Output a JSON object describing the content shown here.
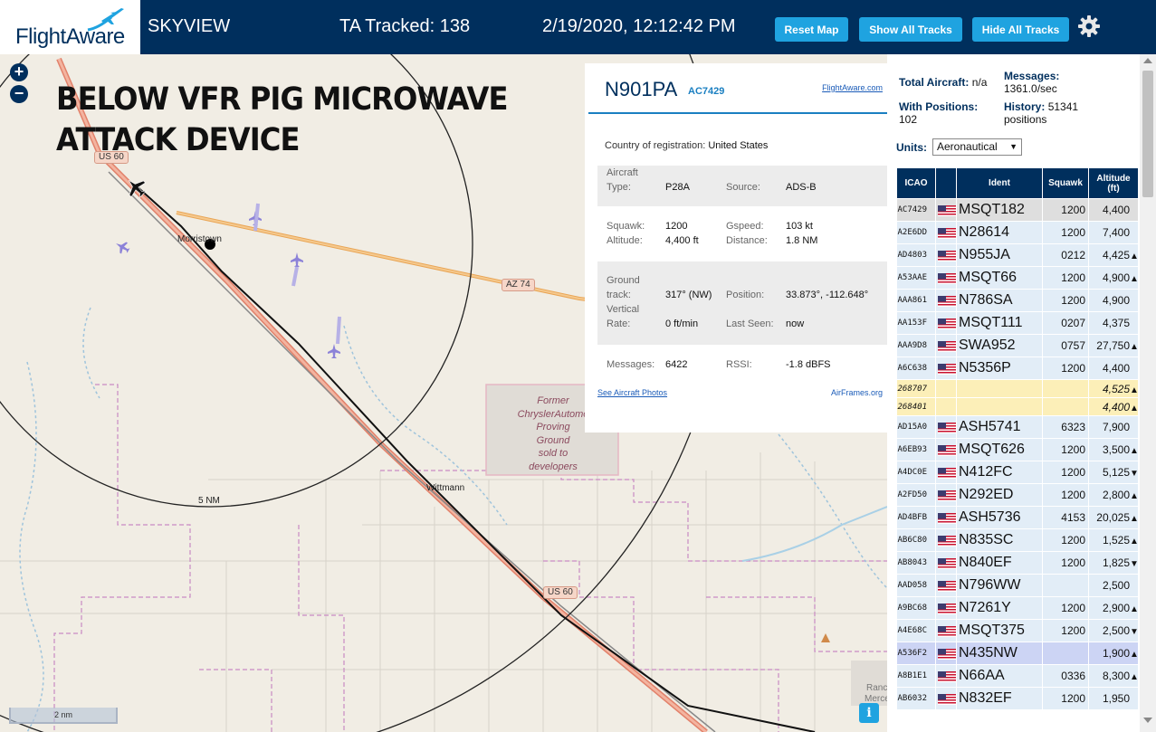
{
  "header": {
    "logo_text": "FlightAware",
    "title": "SKYVIEW",
    "tracked": "TA Tracked: 138",
    "datetime": "2/19/2020, 12:12:42 PM",
    "buttons": {
      "reset": "Reset Map",
      "show": "Show All Tracks",
      "hide": "Hide All Tracks"
    },
    "colors": {
      "bar": "#002f5d",
      "button": "#1fa3e0"
    }
  },
  "map": {
    "zoom_in": "+",
    "zoom_out": "−",
    "overlay_text": [
      "BELOW VFR PIG MICROWAVE",
      "ATTACK DEVICE"
    ],
    "places": {
      "morristown": "Morristown",
      "wittmann": "Wittmann",
      "rancho": "Ranc",
      "mercer": "Merce"
    },
    "shields": {
      "us60_top": "US 60",
      "az74": "AZ 74",
      "us60_bottom": "US 60"
    },
    "proving_ground": [
      "Former",
      "ChryslerAutomo",
      "Proving",
      "Ground",
      "sold to",
      "developers"
    ],
    "ring_label": "5 NM",
    "scale": "2 nm",
    "info": "i"
  },
  "popup": {
    "ident": "N901PA",
    "icao": "AC7429",
    "fa_link": "FlightAware.com",
    "country_label": "Country of registration:",
    "country": "United States",
    "aircraft_label": "Aircraft",
    "type_label": "Type:",
    "type": "P28A",
    "source_label": "Source:",
    "source": "ADS-B",
    "squawk_label": "Squawk:",
    "squawk": "1200",
    "altitude_label": "Altitude:",
    "altitude": "4,400 ft",
    "gspeed_label": "Gspeed:",
    "gspeed": "103 kt",
    "distance_label": "Distance:",
    "distance": "1.8 NM",
    "ground_label": "Ground",
    "track_label": "track:",
    "track": "317° (NW)",
    "position_label": "Position:",
    "position": "33.873°, -112.648°",
    "vertical_label": "Vertical",
    "rate_label": "Rate:",
    "rate": "0 ft/min",
    "lastseen_label": "Last Seen:",
    "lastseen": "now",
    "messages_label": "Messages:",
    "messages": "6422",
    "rssi_label": "RSSI:",
    "rssi": "-1.8 dBFS",
    "photos_link": "See Aircraft Photos",
    "airframes_link": "AirFrames.org"
  },
  "sidebar": {
    "total_label": "Total Aircraft:",
    "total": "n/a",
    "messages_label": "Messages:",
    "messages": "1361.0/sec",
    "positions_label": "With Positions:",
    "positions": "102",
    "history_label": "History:",
    "history": "51341",
    "history_unit": "positions",
    "units_label": "Units:",
    "units_value": "Aeronautical",
    "columns": {
      "icao": "ICAO",
      "ident": "Ident",
      "squawk": "Squawk",
      "alt1": "Altitude",
      "alt2": "(ft)"
    },
    "rows": [
      {
        "icao": "AC7429",
        "ident": "MSQT182",
        "squawk": "1200",
        "alt": "4,400",
        "trend": "",
        "flag": true,
        "style": "selected"
      },
      {
        "icao": "A2E6DD",
        "ident": "N28614",
        "squawk": "1200",
        "alt": "7,400",
        "trend": "",
        "flag": true,
        "style": ""
      },
      {
        "icao": "AD4803",
        "ident": "N955JA",
        "squawk": "0212",
        "alt": "4,425",
        "trend": "▲",
        "flag": true,
        "style": ""
      },
      {
        "icao": "A53AAE",
        "ident": "MSQT66",
        "squawk": "1200",
        "alt": "4,900",
        "trend": "▲",
        "flag": true,
        "style": ""
      },
      {
        "icao": "AAA861",
        "ident": "N786SA",
        "squawk": "1200",
        "alt": "4,900",
        "trend": "",
        "flag": true,
        "style": ""
      },
      {
        "icao": "AA153F",
        "ident": "MSQT111",
        "squawk": "0207",
        "alt": "4,375",
        "trend": "",
        "flag": true,
        "style": ""
      },
      {
        "icao": "AAA9D8",
        "ident": "SWA952",
        "squawk": "0757",
        "alt": "27,750",
        "trend": "▲",
        "flag": true,
        "style": ""
      },
      {
        "icao": "A6C638",
        "ident": "N5356P",
        "squawk": "1200",
        "alt": "4,400",
        "trend": "",
        "flag": true,
        "style": ""
      },
      {
        "icao": "268707",
        "ident": "",
        "squawk": "",
        "alt": "4,525",
        "trend": "▲",
        "flag": false,
        "style": "anon"
      },
      {
        "icao": "268401",
        "ident": "",
        "squawk": "",
        "alt": "4,400",
        "trend": "▲",
        "flag": false,
        "style": "anon"
      },
      {
        "icao": "AD15A0",
        "ident": "ASH5741",
        "squawk": "6323",
        "alt": "7,900",
        "trend": "",
        "flag": true,
        "style": ""
      },
      {
        "icao": "A6EB93",
        "ident": "MSQT626",
        "squawk": "1200",
        "alt": "3,500",
        "trend": "▲",
        "flag": true,
        "style": ""
      },
      {
        "icao": "A4DC0E",
        "ident": "N412FC",
        "squawk": "1200",
        "alt": "5,125",
        "trend": "▼",
        "flag": true,
        "style": ""
      },
      {
        "icao": "A2FD50",
        "ident": "N292ED",
        "squawk": "1200",
        "alt": "2,800",
        "trend": "▲",
        "flag": true,
        "style": ""
      },
      {
        "icao": "AD4BFB",
        "ident": "ASH5736",
        "squawk": "4153",
        "alt": "20,025",
        "trend": "▲",
        "flag": true,
        "style": ""
      },
      {
        "icao": "AB6C80",
        "ident": "N835SC",
        "squawk": "1200",
        "alt": "1,525",
        "trend": "▲",
        "flag": true,
        "style": ""
      },
      {
        "icao": "AB8043",
        "ident": "N840EF",
        "squawk": "1200",
        "alt": "1,825",
        "trend": "▼",
        "flag": true,
        "style": ""
      },
      {
        "icao": "AAD058",
        "ident": "N796WW",
        "squawk": "",
        "alt": "2,500",
        "trend": "",
        "flag": true,
        "style": ""
      },
      {
        "icao": "A9BC68",
        "ident": "N7261Y",
        "squawk": "1200",
        "alt": "2,900",
        "trend": "▲",
        "flag": true,
        "style": ""
      },
      {
        "icao": "A4E68C",
        "ident": "MSQT375",
        "squawk": "1200",
        "alt": "2,500",
        "trend": "▼",
        "flag": true,
        "style": ""
      },
      {
        "icao": "A536F2",
        "ident": "N435NW",
        "squawk": "",
        "alt": "1,900",
        "trend": "▲",
        "flag": true,
        "style": "highlight"
      },
      {
        "icao": "A8B1E1",
        "ident": "N66AA",
        "squawk": "0336",
        "alt": "8,300",
        "trend": "▲",
        "flag": true,
        "style": ""
      },
      {
        "icao": "AB6032",
        "ident": "N832EF",
        "squawk": "1200",
        "alt": "1,950",
        "trend": "",
        "flag": true,
        "style": ""
      }
    ]
  }
}
